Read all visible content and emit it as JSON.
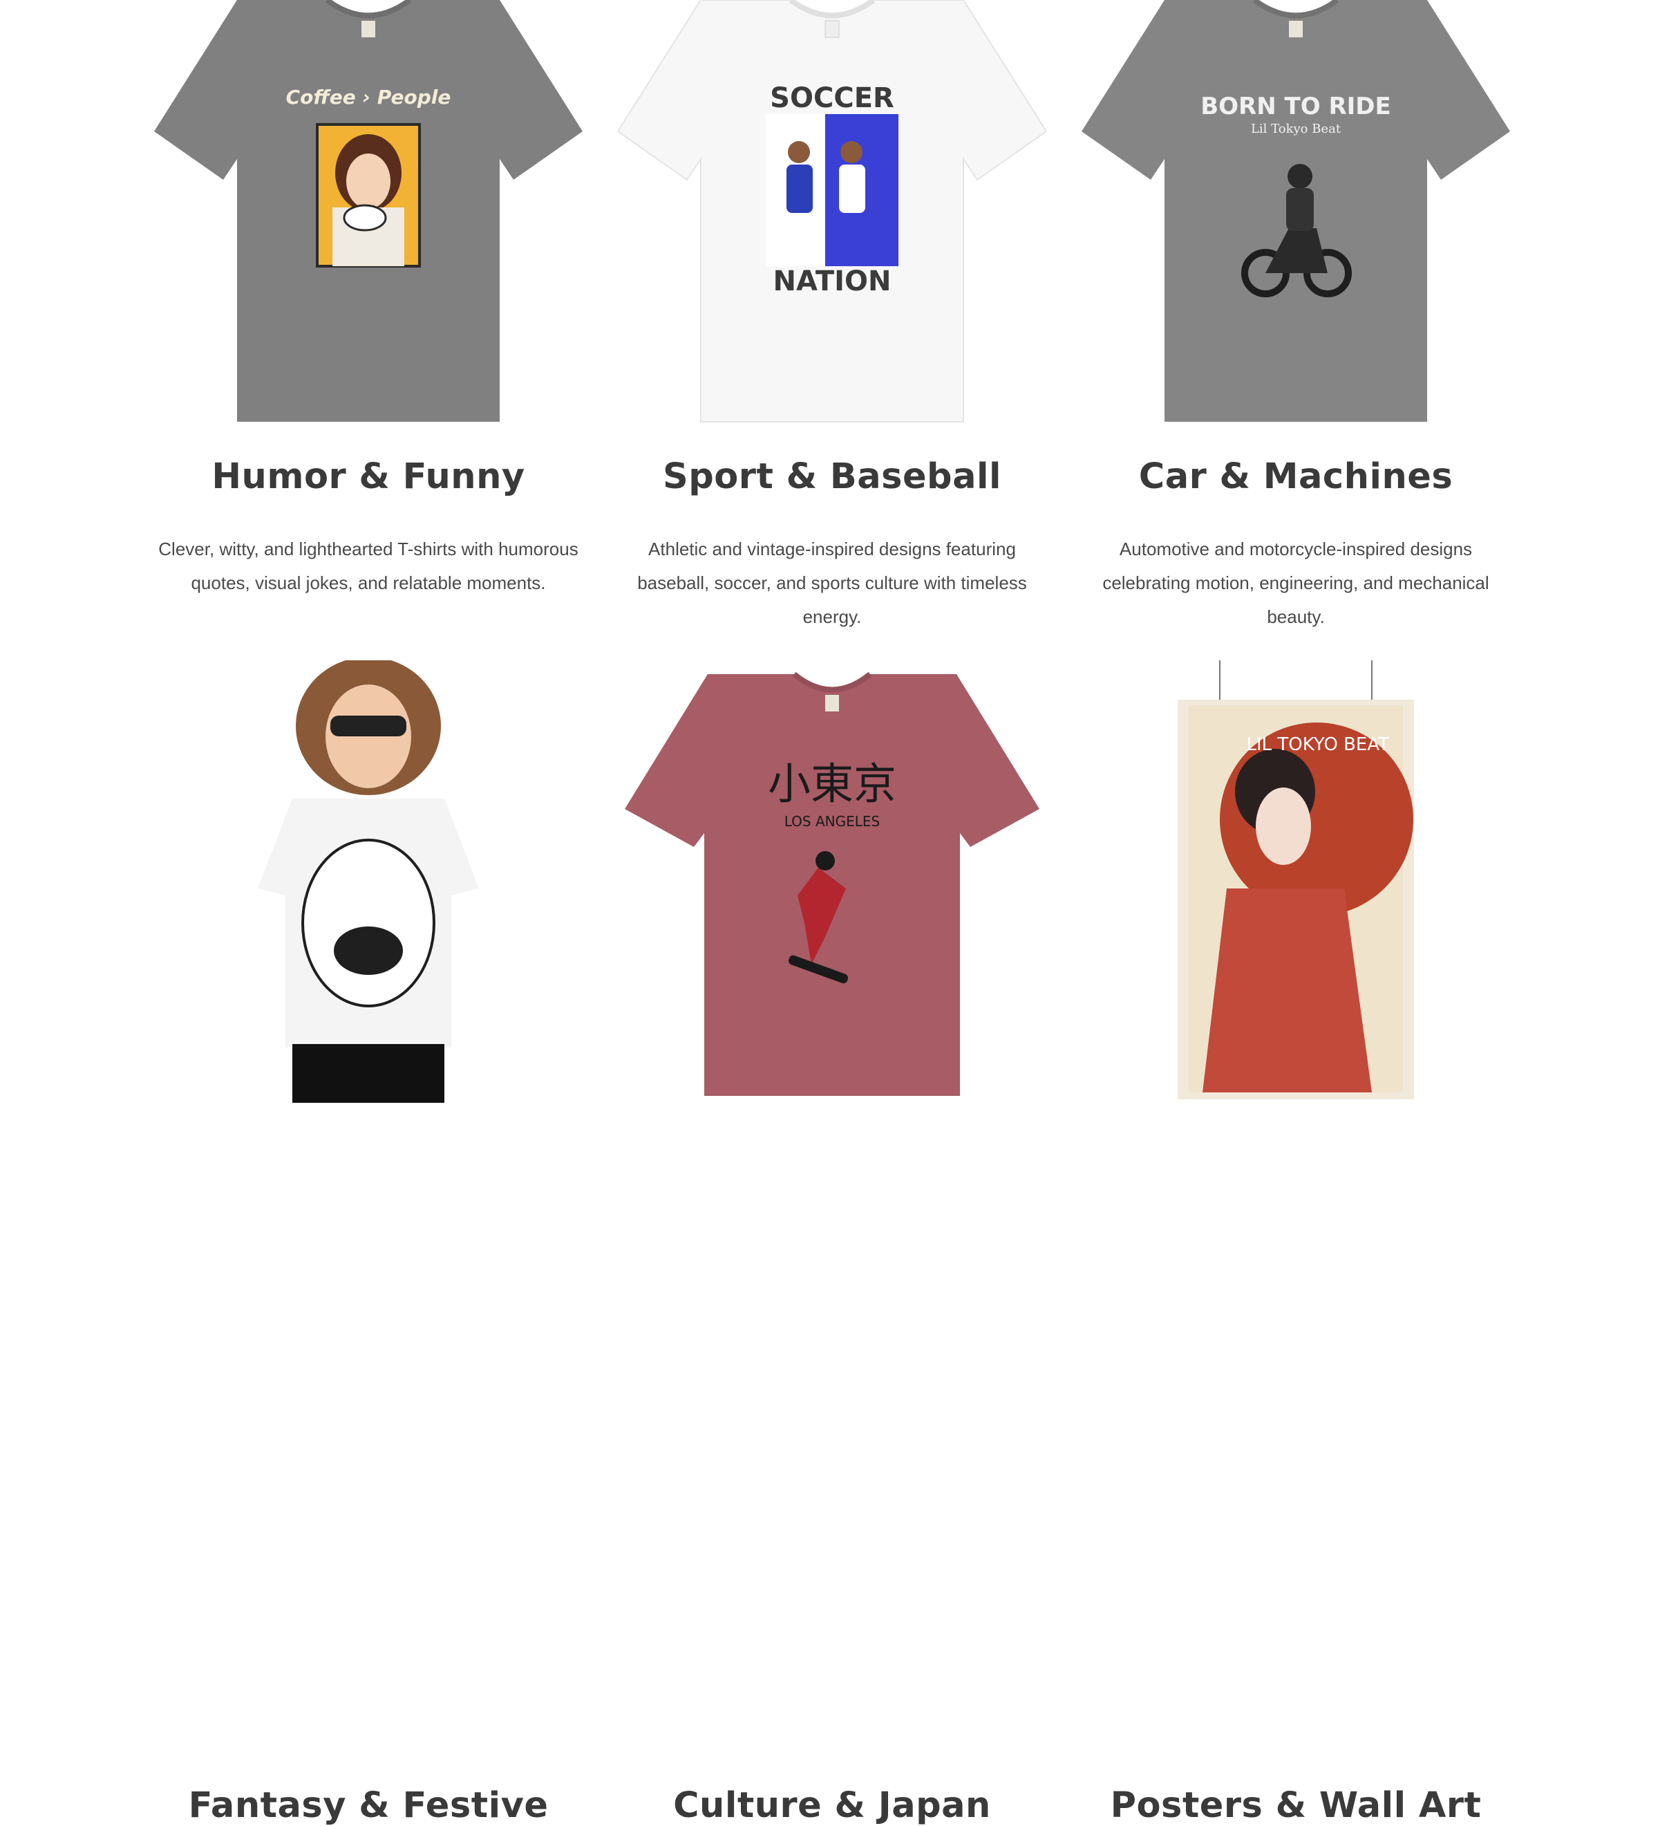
{
  "categories": [
    {
      "title": "Humor & Funny",
      "description": "Clever, witty, and lighthearted T-shirts with humorous quotes, visual jokes, and relatable moments.",
      "image": {
        "type": "t-shirt",
        "shirt_color": "#808080",
        "print_text": "Coffee › People"
      }
    },
    {
      "title": "Sport & Baseball",
      "description": "Athletic and vintage-inspired designs featuring baseball, soccer, and sports culture with timeless energy.",
      "image": {
        "type": "t-shirt",
        "shirt_color": "#f7f7f7",
        "print_text_top": "SOCCER",
        "print_text_bottom": "NATION"
      }
    },
    {
      "title": "Car & Machines",
      "description": "Automotive and motorcycle-inspired designs celebrating motion, engineering, and mechanical beauty.",
      "image": {
        "type": "t-shirt",
        "shirt_color": "#858585",
        "print_text": "BORN TO RIDE",
        "print_subtext": "Lil Tokyo Beat"
      }
    },
    {
      "title": "Fantasy & Festive",
      "description": "",
      "image": {
        "type": "model-photo",
        "shirt_color": "#f4f4f4"
      }
    },
    {
      "title": "Culture & Japan",
      "description": "",
      "image": {
        "type": "t-shirt",
        "shirt_color": "#a85c66",
        "print_text": "小東京",
        "print_subtext": "LOS ANGELES"
      }
    },
    {
      "title": "Posters & Wall Art",
      "description": "",
      "image": {
        "type": "poster",
        "print_text": "LIL TOKYO BEAT"
      }
    }
  ]
}
